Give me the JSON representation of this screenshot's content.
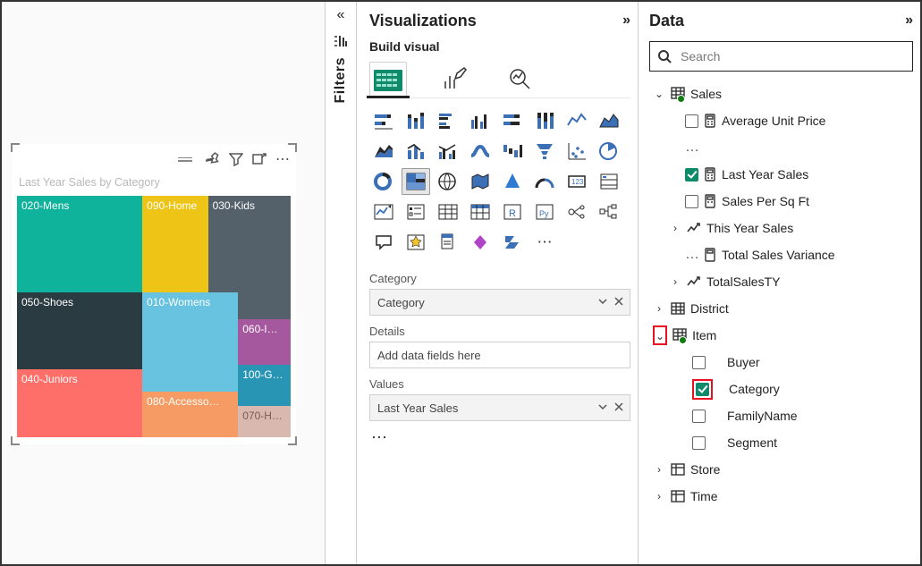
{
  "panes": {
    "filters": {
      "label": "Filters"
    },
    "visualizations": {
      "title": "Visualizations",
      "subtitle": "Build visual"
    },
    "data": {
      "title": "Data",
      "search_placeholder": "Search"
    }
  },
  "treemap_title": "Last Year Sales by Category",
  "chart_data": {
    "type": "treemap",
    "title": "Last Year Sales by Category",
    "note": "Tile areas approximate relative Last Year Sales share; numeric values are not shown in the visual so only relative sizes are estimated.",
    "tiles": [
      {
        "label": "020-Mens",
        "approx_share": 0.2,
        "color": "#0fb29b"
      },
      {
        "label": "090-Home",
        "approx_share": 0.1,
        "color": "#eec416"
      },
      {
        "label": "030-Kids",
        "approx_share": 0.12,
        "color": "#55616a"
      },
      {
        "label": "050-Shoes",
        "approx_share": 0.14,
        "color": "#2b3b42"
      },
      {
        "label": "010-Womens",
        "approx_share": 0.13,
        "color": "#67c3e0"
      },
      {
        "label": "060-I…",
        "approx_share": 0.05,
        "color": "#a6589e"
      },
      {
        "label": "040-Juniors",
        "approx_share": 0.12,
        "color": "#ff6f69"
      },
      {
        "label": "100-G…",
        "approx_share": 0.05,
        "color": "#2895b5"
      },
      {
        "label": "080-Accesso…",
        "approx_share": 0.06,
        "color": "#f59b63"
      },
      {
        "label": "070-H…",
        "approx_share": 0.03,
        "color": "#d9b8b0"
      }
    ]
  },
  "field_wells": {
    "category_label": "Category",
    "category_value": "Category",
    "details_label": "Details",
    "details_value": "Add data fields here",
    "values_label": "Values",
    "values_value": "Last Year Sales"
  },
  "data_tree": {
    "sales": {
      "label": "Sales",
      "fields": {
        "avg_unit_price": "Average Unit Price",
        "last_year_sales": "Last Year Sales",
        "sales_per_sq_ft": "Sales Per Sq Ft",
        "this_year_sales": "This Year Sales",
        "total_sales_variance": "Total Sales Variance",
        "total_sales_ty": "TotalSalesTY"
      }
    },
    "district": "District",
    "item": {
      "label": "Item",
      "fields": {
        "buyer": "Buyer",
        "category": "Category",
        "family_name": "FamilyName",
        "segment": "Segment"
      }
    },
    "store": "Store",
    "time": "Time"
  }
}
